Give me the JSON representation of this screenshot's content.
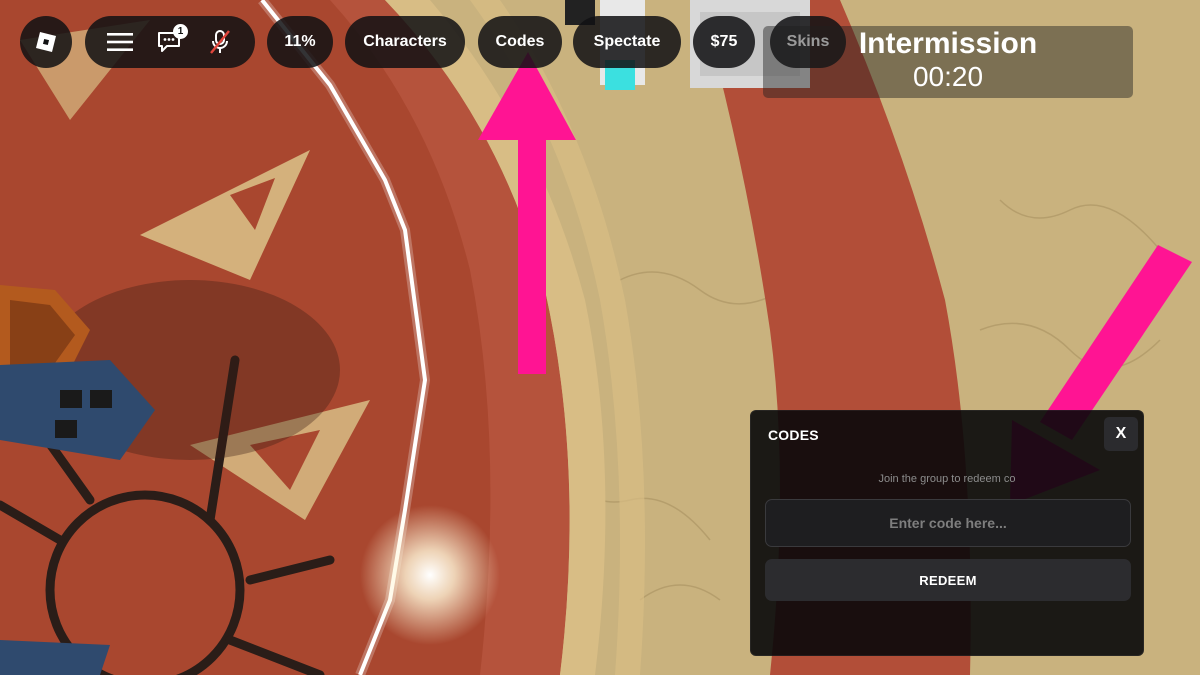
{
  "colors": {
    "floor": "#c9b27e",
    "ring": "#b24e38",
    "annotation_arrow": "#ff1493",
    "panel_bg": "#0a0a0c",
    "pill_bg": "#121214"
  },
  "topbar": {
    "logo_icon": "roblox-logo-icon",
    "menu_icon": "hamburger-menu-icon",
    "chat_icon": "chat-icon",
    "chat_badge": "1",
    "mic_icon": "microphone-muted-icon",
    "buttons": {
      "percent": "11%",
      "characters": "Characters",
      "codes": "Codes",
      "spectate": "Spectate",
      "money": "$75",
      "skins": "Skins"
    }
  },
  "intermission": {
    "title": "Intermission",
    "timer": "00:20"
  },
  "codes_panel": {
    "title": "CODES",
    "close_label": "X",
    "hint": "Join the group to redeem co",
    "input_placeholder": "Enter code here...",
    "input_value": "",
    "redeem_label": "REDEEM"
  }
}
